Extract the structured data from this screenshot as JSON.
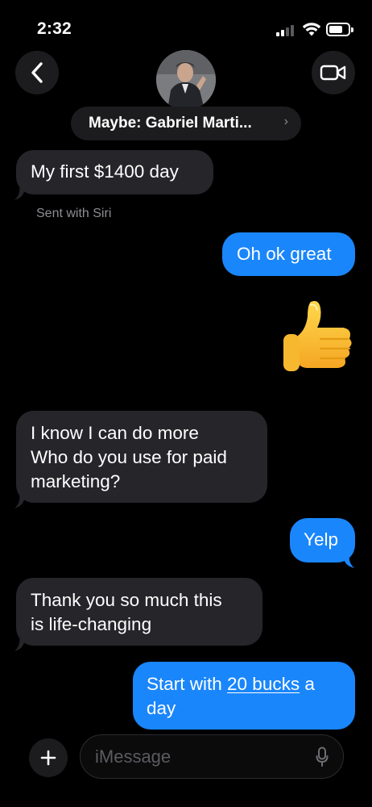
{
  "status_bar": {
    "time": "2:32"
  },
  "header": {
    "contact_name": "Maybe: Gabriel Marti...",
    "chevron": "›"
  },
  "messages": [
    {
      "direction": "incoming",
      "text": "My first $1400 day"
    },
    {
      "direction": "incoming_note",
      "text": "Sent with Siri"
    },
    {
      "direction": "outgoing",
      "text": "Oh ok great"
    },
    {
      "direction": "outgoing",
      "type": "emoji",
      "text": "👍"
    },
    {
      "direction": "incoming",
      "lines": [
        "I know I can do more",
        "Who do you use for paid",
        "marketing?"
      ]
    },
    {
      "direction": "outgoing",
      "text": "Yelp"
    },
    {
      "direction": "incoming",
      "lines": [
        "Thank you so much this",
        "is life-changing"
      ]
    },
    {
      "direction": "outgoing",
      "parts": [
        "Start with ",
        "20 bucks",
        " a",
        "day"
      ]
    }
  ],
  "composer": {
    "placeholder": "iMessage"
  },
  "colors": {
    "outgoing": "#1a86fb",
    "incoming": "#26252a",
    "background": "#000000"
  },
  "icons": [
    "back-chevron-icon",
    "video-camera-icon",
    "plus-icon",
    "microphone-icon",
    "signal-icon",
    "wifi-icon",
    "battery-icon"
  ]
}
